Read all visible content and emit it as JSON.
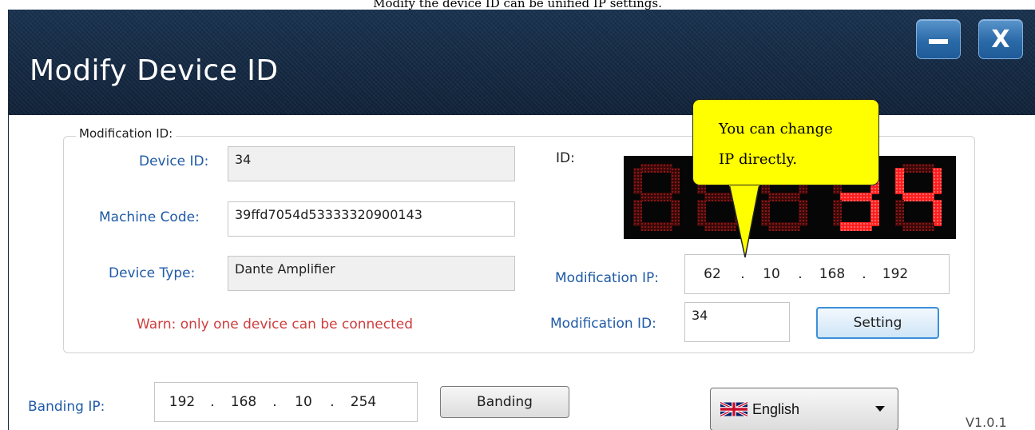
{
  "top_caption": "Modify the device ID can be unified IP settings.",
  "window": {
    "title": "Modify Device ID",
    "minimize_label": "",
    "close_label": "X"
  },
  "group": {
    "legend": "Modification ID:",
    "device_id_label": "Device ID:",
    "device_id_value": "34",
    "machine_code_label": "Machine Code:",
    "machine_code_value": "39ffd7054d53333320900143",
    "device_type_label": "Device Type:",
    "device_type_value": "Dante Amplifier",
    "warning": "Warn: only one device can be connected",
    "id_label": "ID:",
    "led_digits": [
      "",
      "",
      "",
      "3",
      "4"
    ],
    "modification_ip_label": "Modification IP:",
    "modification_ip": [
      "62",
      "10",
      "168",
      "192"
    ],
    "modification_id_label": "Modification ID:",
    "modification_id_value": "34",
    "setting_button": "Setting"
  },
  "callout": {
    "line1": "You can change",
    "line2": "IP directly."
  },
  "banding": {
    "label": "Banding IP:",
    "ip": [
      "192",
      "168",
      "10",
      "254"
    ],
    "button": "Banding"
  },
  "language": {
    "selected": "English",
    "flag_icon": "uk-flag-icon"
  },
  "version": "V1.0.1",
  "colors": {
    "label_blue": "#1f5aa6",
    "warning_red": "#d03c3c",
    "led_red": "#ff1d1d",
    "callout_yellow": "#ffff00",
    "titlebar": "#15263a"
  }
}
